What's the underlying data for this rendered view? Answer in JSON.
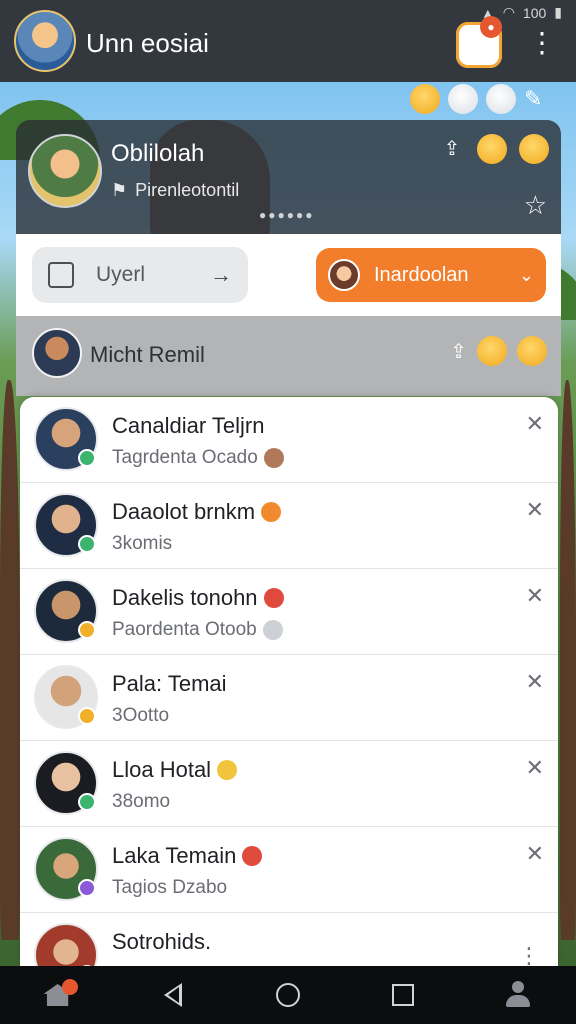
{
  "app_bar": {
    "title": "Unn eosiai",
    "status": {
      "battery": "100"
    }
  },
  "profile": {
    "name": "Oblilolah",
    "subtitle": "Pirenleotontil"
  },
  "actions": {
    "user_button_label": "Uyerl",
    "orange_button_label": "Inardoolan"
  },
  "highlight": {
    "name": "Micht Remil"
  },
  "friends": [
    {
      "name": "Canaldiar Teljrn",
      "sub": "Tagrdenta Ocado",
      "badge_color": "#3cb46e"
    },
    {
      "name": "Daaolot brnkm",
      "sub": "3komis",
      "badge_color": "#3cb46e"
    },
    {
      "name": "Dakelis tonohn",
      "sub": "Paordenta Otoob",
      "badge_color": "#f2b02a"
    },
    {
      "name": "Pala: Temai",
      "sub": "3Ootto",
      "badge_color": "#f2b02a"
    },
    {
      "name": "Lloa Hotal",
      "sub": "38omo",
      "badge_color": "#3cb46e"
    },
    {
      "name": "Laka Temain",
      "sub": "Tagios Dzabo",
      "badge_color": "#8a5ad8"
    },
    {
      "name": "Sotrohids.",
      "sub": "",
      "badge_color": "#f08a2a"
    }
  ],
  "icons": {
    "mascot": "mascot-icon",
    "more": "more-vert-icon",
    "share": "share-icon",
    "star": "star-outline-icon",
    "close": "close-icon",
    "nav": [
      "home-icon",
      "back-icon",
      "home-circle-icon",
      "recent-apps-icon",
      "profile-icon"
    ]
  },
  "colors": {
    "accent_orange": "#f27d2a",
    "app_bar": "#33373e",
    "badge_red": "#e5572f"
  }
}
